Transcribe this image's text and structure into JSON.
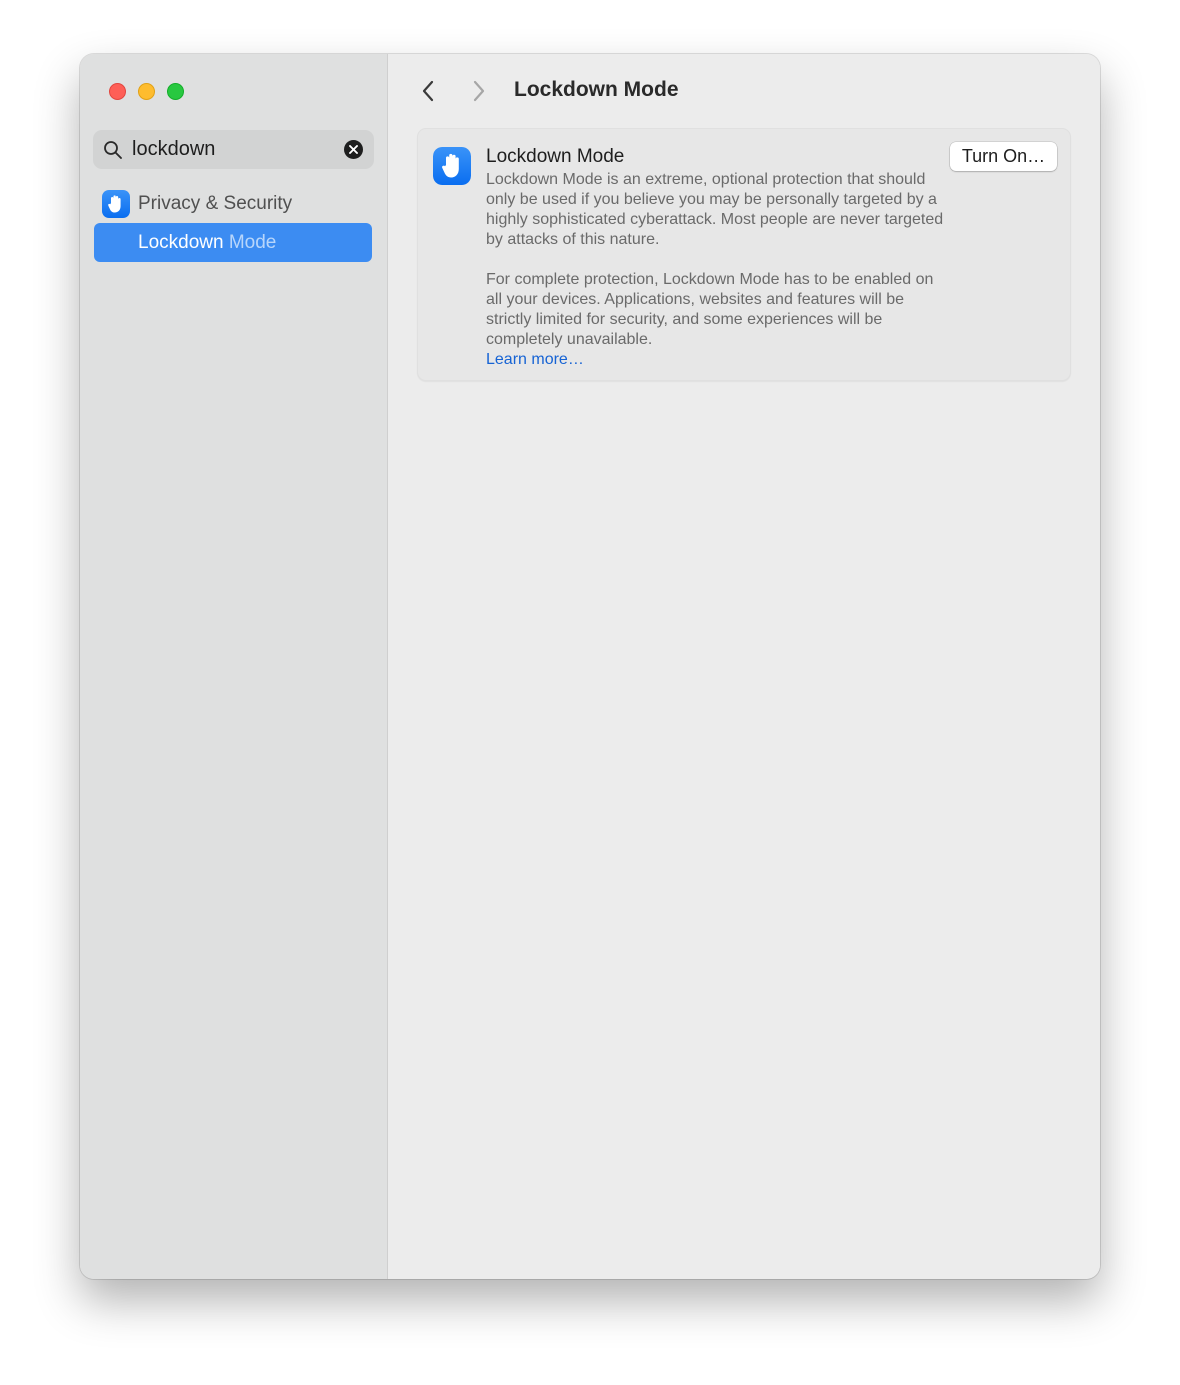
{
  "window": {
    "traffic_lights": [
      {
        "name": "close",
        "color": "#fe5f57"
      },
      {
        "name": "minimize",
        "color": "#febc2e"
      },
      {
        "name": "zoom",
        "color": "#28c840"
      }
    ]
  },
  "sidebar": {
    "search": {
      "icon": "magnifying-glass-icon",
      "value": "lockdown",
      "placeholder": "Search",
      "clear_icon": "clear-x-circle-icon"
    },
    "results": [
      {
        "label": "Privacy & Security",
        "icon": "raised-hand-icon",
        "selected": false
      },
      {
        "label_match": "Lockdown",
        "label_rest": " Mode",
        "selected": true
      }
    ],
    "accent_color": "#3c8cf2"
  },
  "toolbar": {
    "back_icon": "chevron-left-icon",
    "forward_icon": "chevron-right-icon",
    "title": "Lockdown Mode"
  },
  "card": {
    "icon": "raised-hand-icon",
    "title": "Lockdown Mode",
    "paragraph1": "Lockdown Mode is an extreme, optional protection that should only be used if you believe you may be personally targeted by a highly sophisticated cyberattack. Most people are never targeted by attacks of this nature.",
    "paragraph2": "For complete protection, Lockdown Mode has to be enabled on all your devices. Applications, websites and features will be strictly limited for security, and some experiences will be completely unavailable.",
    "link_label": "Learn more…",
    "button_label": "Turn On…",
    "link_color": "#1663d4"
  }
}
